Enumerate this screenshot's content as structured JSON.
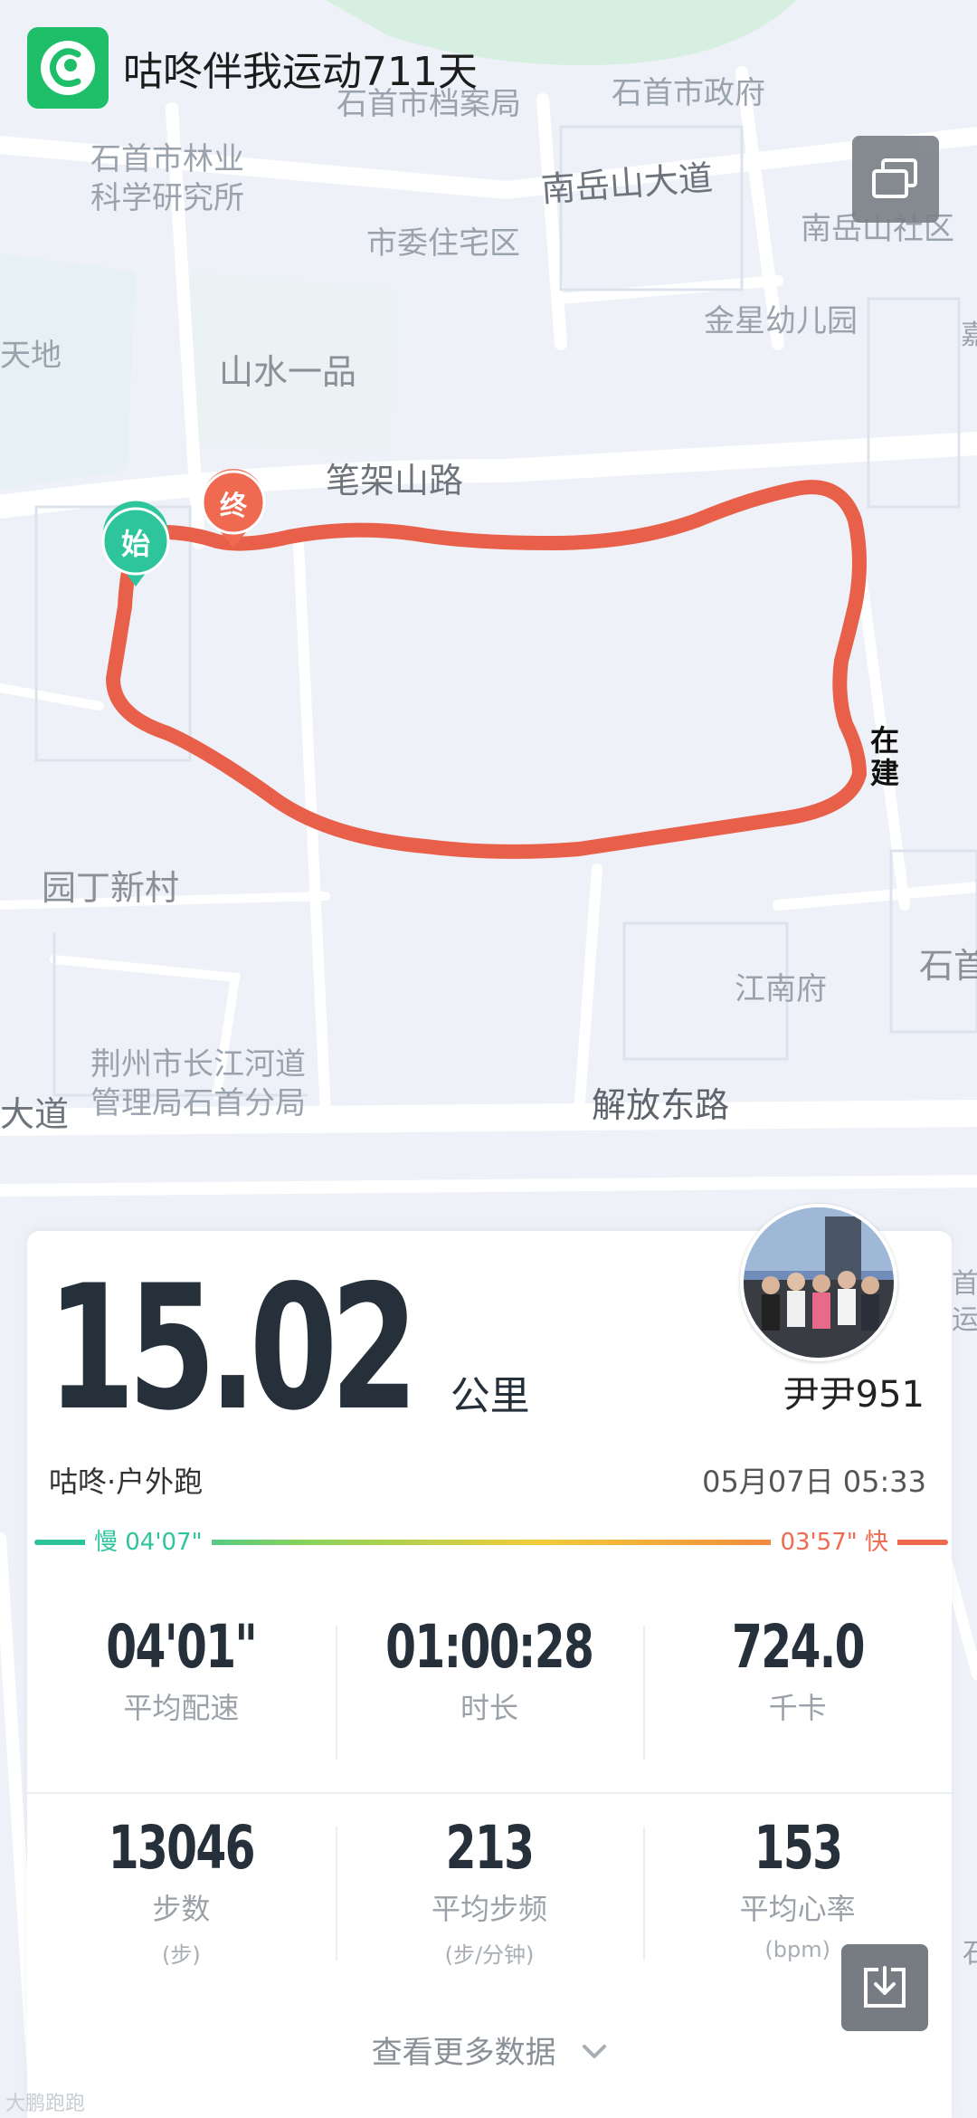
{
  "header": {
    "title": "咕咚伴我运动711天"
  },
  "map": {
    "labels": [
      "石首市档案局",
      "石首市政府",
      "石首市林业科学研究所",
      "南岳山大道",
      "南岳山社区",
      "市委住宅区",
      "金星幼儿园",
      "天地",
      "山水一品",
      "笔架山路",
      "园丁新村",
      "江南府",
      "石首",
      "荆州市长江河道管理局石首分局",
      "大道",
      "解放东路",
      "首",
      "运",
      "嘉",
      "石"
    ],
    "construction_label": "在建",
    "start_marker": "始",
    "end_marker": "终"
  },
  "card": {
    "distance": "15.02",
    "distance_unit": "公里",
    "username": "尹尹951",
    "activity_type": "咕咚·户外跑",
    "datetime": "05月07日 05:33",
    "pace_slow": "慢 04'07\"",
    "pace_fast": "03'57\" 快",
    "stats_row1": [
      {
        "value": "04'01\"",
        "label": "平均配速"
      },
      {
        "value": "01:00:28",
        "label": "时长"
      },
      {
        "value": "724.0",
        "label": "千卡"
      }
    ],
    "stats_row2": [
      {
        "value": "13046",
        "label": "步数",
        "unit": "(步)"
      },
      {
        "value": "213",
        "label": "平均步频",
        "unit": "(步/分钟)"
      },
      {
        "value": "153",
        "label": "平均心率",
        "unit": "(bpm)"
      }
    ],
    "more_label": "查看更多数据"
  },
  "watermark": "大鹏跑跑",
  "colors": {
    "route": "#e8604a",
    "brand": "#1fbf6a",
    "start": "#2ec59d",
    "end": "#ef6a50"
  }
}
